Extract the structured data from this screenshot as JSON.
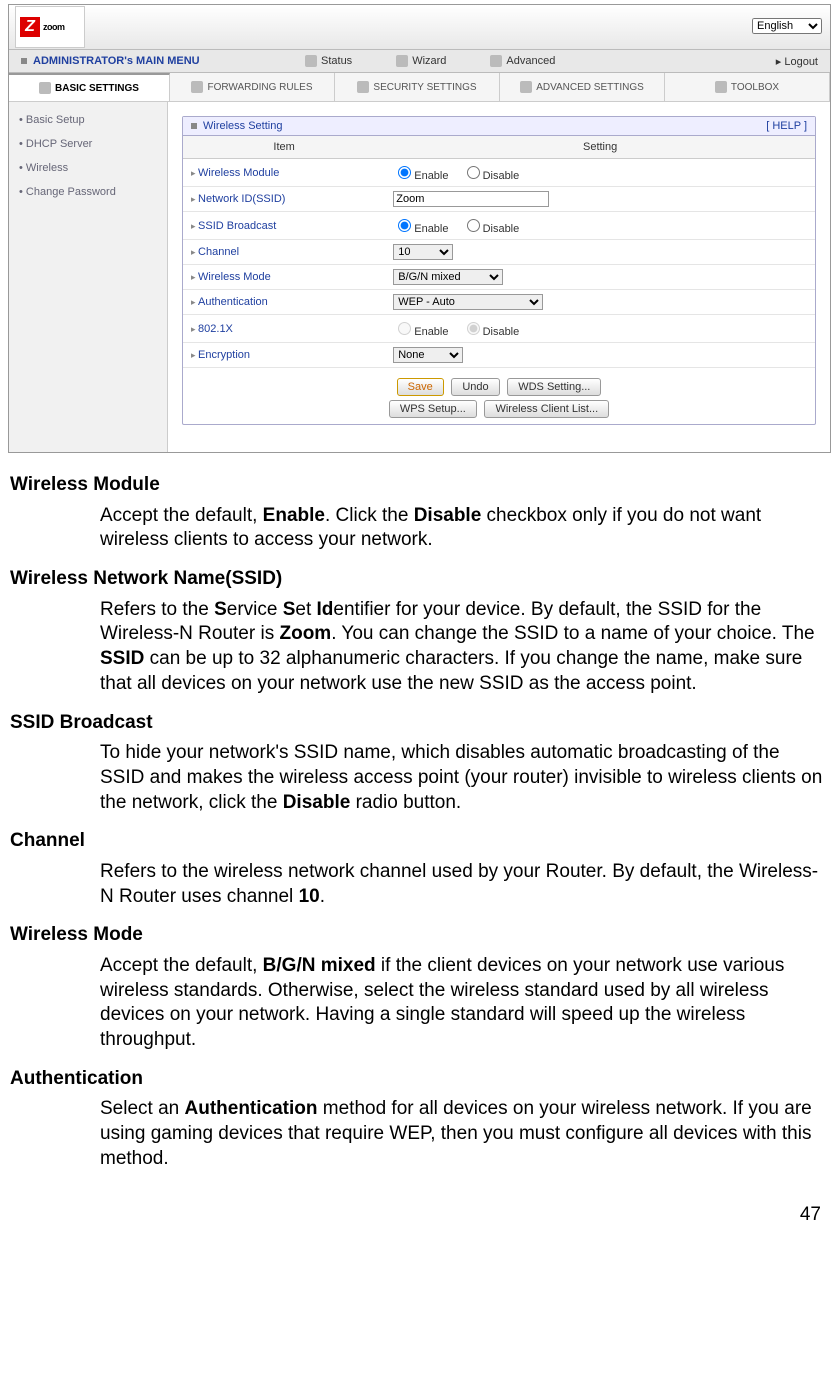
{
  "logo_text": "zoom",
  "language": "English",
  "main_menu": {
    "title": "ADMINISTRATOR's MAIN MENU",
    "status": "Status",
    "wizard": "Wizard",
    "advanced": "Advanced",
    "logout": "Logout"
  },
  "sub_tabs": {
    "basic": "BASIC SETTINGS",
    "forwarding": "FORWARDING RULES",
    "security": "SECURITY SETTINGS",
    "advanced": "ADVANCED SETTINGS",
    "toolbox": "TOOLBOX"
  },
  "sidebar": [
    "Basic Setup",
    "DHCP Server",
    "Wireless",
    "Change Password"
  ],
  "panel": {
    "title": "Wireless Setting",
    "help": "[ HELP ]",
    "col_item": "Item",
    "col_setting": "Setting",
    "rows": {
      "wireless_module": "Wireless Module",
      "network_id": "Network ID(SSID)",
      "ssid_broadcast": "SSID Broadcast",
      "channel": "Channel",
      "wireless_mode": "Wireless Mode",
      "authentication": "Authentication",
      "dot1x": "802.1X",
      "encryption": "Encryption"
    },
    "values": {
      "enable": "Enable",
      "disable": "Disable",
      "ssid": "Zoom",
      "channel": "10",
      "mode": "B/G/N mixed",
      "auth": "WEP - Auto",
      "encryption": "None"
    },
    "buttons": {
      "save": "Save",
      "undo": "Undo",
      "wds": "WDS Setting...",
      "wps": "WPS Setup...",
      "clients": "Wireless Client List..."
    }
  },
  "doc": {
    "h1": "Wireless Module",
    "p1a": "Accept the default, ",
    "p1b": "Enable",
    "p1c": ". Click the ",
    "p1d": "Disable",
    "p1e": " checkbox only if you do not want wireless clients to access your network.",
    "h2": "Wireless Network Name(SSID)",
    "p2a": "Refers to the ",
    "p2b": "S",
    "p2c": "ervice ",
    "p2d": "S",
    "p2e": "et ",
    "p2f": "Id",
    "p2g": "entifier for your device. By default, the SSID for the Wireless-N Router is ",
    "p2h": "Zoom",
    "p2i": ". You can change the SSID to a name of your choice. The ",
    "p2j": "SSID",
    "p2k": " can be up to 32 alphanumeric characters. If you change the name, make sure that all devices on your network use the new SSID as the access point.",
    "h3": "SSID Broadcast",
    "p3a": "To hide your network's SSID name, which disables automatic broadcasting of the SSID and makes the wireless access point (your router) invisible to wireless clients on the network, click the ",
    "p3b": "Disable",
    "p3c": " radio button.",
    "h4": "Channel",
    "p4a": "Refers to the wireless network channel used by your Router. By default, the Wireless-N Router uses channel ",
    "p4b": "10",
    "p4c": ".",
    "h5": "Wireless Mode",
    "p5a": "Accept the default, ",
    "p5b": "B/G/N mixed",
    "p5c": " if the client devices on your network use various wireless standards. Otherwise, select the wireless standard used by all wireless devices on your network. Having a single standard will speed up the wireless throughput.",
    "h6": "Authentication",
    "p6a": "Select an ",
    "p6b": "Authentication",
    "p6c": " method for all devices on your wireless network. If you are using gaming devices that require WEP, then you must configure all devices with this method."
  },
  "page_num": "47"
}
